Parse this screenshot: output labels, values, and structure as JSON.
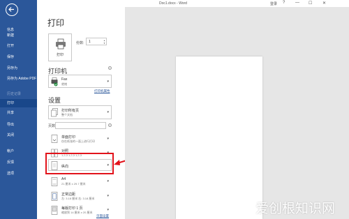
{
  "titlebar": {
    "doc_title": "Doc1.docx - Word",
    "sign_in": "登录",
    "help": "?",
    "minimize": "—",
    "restore": "☐",
    "close": "✕"
  },
  "sidebar": {
    "items": [
      {
        "label": "信息"
      },
      {
        "label": "新建"
      },
      {
        "label": "打开"
      },
      {
        "label": "保存"
      },
      {
        "label": "另存为"
      },
      {
        "label": "另存为 Adobe PDF"
      },
      {
        "label": "历史记录"
      },
      {
        "label": "打印"
      },
      {
        "label": "共享"
      },
      {
        "label": "导出"
      },
      {
        "label": "关闭"
      },
      {
        "label": "帐户"
      },
      {
        "label": "反馈"
      },
      {
        "label": "选项"
      }
    ]
  },
  "print": {
    "title": "打印",
    "tile_label": "打印",
    "copies_label": "份数:",
    "copies_value": "1",
    "printer_heading": "打印机",
    "printer_name": "Fax",
    "printer_status": "就绪",
    "printer_props": "打印机属性",
    "settings_heading": "设置",
    "settings": [
      {
        "main": "打印所有页",
        "sub": "整个文档"
      },
      {
        "main": "单面打印",
        "sub": "仅在纸张的一面上进行打印"
      },
      {
        "main": "对照",
        "sub": "1,2,3    1,2,3    1,2,3"
      },
      {
        "main": "纵向",
        "sub": ""
      },
      {
        "main": "A4",
        "sub": "21 厘米 x 29.7 厘米"
      },
      {
        "main": "正常边距",
        "sub": "左: 3.18 厘米   右: 3.18 厘米"
      },
      {
        "main": "每版打印 1 页",
        "sub": "缩放到 14 厘米 x 20 厘米"
      }
    ],
    "pages_label": "页数:",
    "page_setup": "页面设置"
  },
  "watermark": "爱创根知识网",
  "colors": {
    "sidebar": "#2b579a",
    "highlight": "#e2131b",
    "preview_bg": "#e6e6e6"
  }
}
